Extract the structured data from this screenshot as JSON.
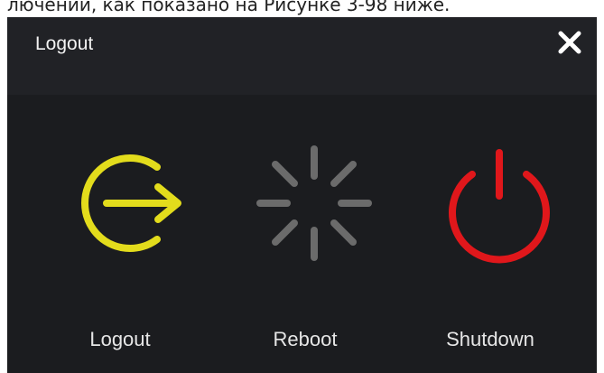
{
  "header_snippet": "лючении, как показано на Рисунке 3-98 ниже.",
  "dialog": {
    "title": "Logout",
    "close_icon": "close-icon"
  },
  "options": [
    {
      "label": "Logout",
      "icon": "logout-icon",
      "color": "#e3dc1c"
    },
    {
      "label": "Reboot",
      "icon": "reboot-spinner-icon",
      "color": "#6b6b6b"
    },
    {
      "label": "Shutdown",
      "icon": "power-icon",
      "color": "#e0171b"
    }
  ],
  "colors": {
    "dialog_bg": "#1b1c1f",
    "titlebar_bg": "#212226",
    "text": "#e6e6e6"
  }
}
